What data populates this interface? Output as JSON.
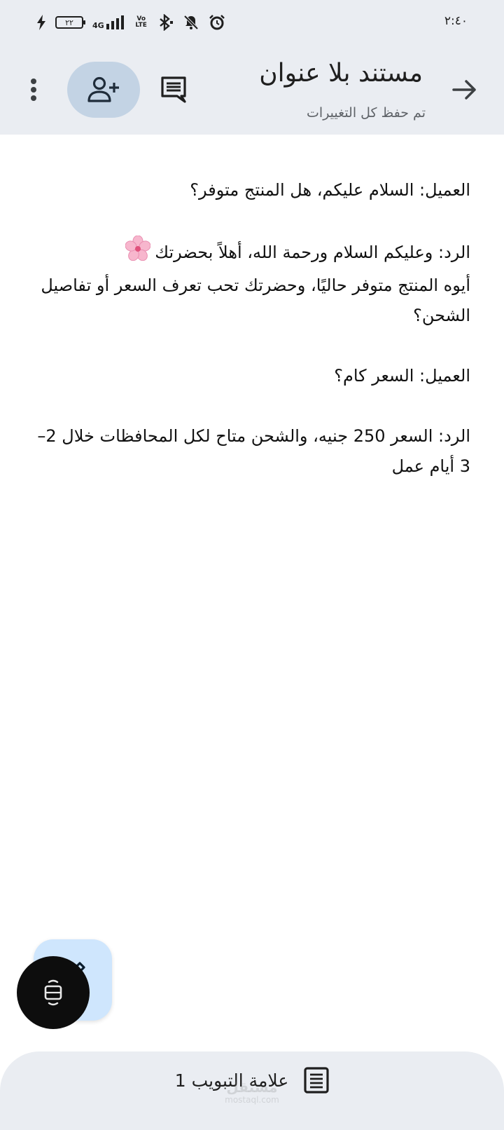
{
  "status_bar": {
    "time": "٢:٤٠",
    "battery_level": "٢٢",
    "network": "4G",
    "volte": "Vo LTE"
  },
  "header": {
    "title": "مستند بلا عنوان",
    "save_status": "تم حفظ كل التغييرات"
  },
  "document": {
    "paragraphs": [
      "العميل: السلام عليكم، هل المنتج متوفر؟",
      "الرد: وعليكم السلام ورحمة الله، أهلاً بحضرتك",
      "أيوه المنتج متوفر حاليًا، وحضرتك تحب تعرف السعر أو تفاصيل الشحن؟",
      "العميل: السعر كام؟",
      "الرد: السعر 250 جنيه، والشحن متاح لكل المحافظات خلال 2–3 أيام عمل"
    ]
  },
  "bottom_bar": {
    "tab_label": "علامة التبويب 1",
    "watermark": "مستقل",
    "watermark_url": "mostaql.com"
  },
  "colors": {
    "header_bg": "#eaedf2",
    "share_button_bg": "#c3d3e4",
    "fab_bg": "#cfe6fd",
    "overlay_bg": "#0d0d0d"
  },
  "icons": {
    "back": "arrow-forward-icon",
    "comments": "comment-icon",
    "share": "person-add-icon",
    "more": "more-vert-icon",
    "edit": "pencil-icon",
    "overlay": "screen-capture-icon",
    "tab": "document-outline-icon"
  }
}
